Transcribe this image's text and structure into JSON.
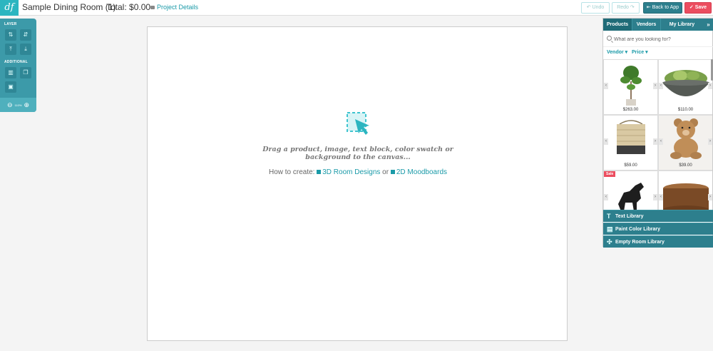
{
  "header": {
    "logo": "df",
    "project_title": "Sample Dining Room (1)",
    "total": "Total: $0.00",
    "project_details": "Project Details",
    "undo": "Undo",
    "redo": "Redo",
    "back_to_app": "Back to App",
    "save": "Save"
  },
  "toolbar": {
    "layer_label": "LAYER",
    "additional_label": "ADDITIONAL",
    "zoom": "110%"
  },
  "canvas": {
    "drop_text": "Drag a product, image, text block, color swatch or background to the canvas...",
    "howto_prefix": "How to create:",
    "link_3d": "3D Room Designs",
    "or_text": "or",
    "link_2d": "2D Moodboards"
  },
  "panel": {
    "tabs": {
      "products": "Products",
      "vendors": "Vendors",
      "library": "My Library",
      "expand": "»"
    },
    "search_placeholder": "What are you looking for?",
    "filter_vendor": "Vendor",
    "filter_price": "Price",
    "products": [
      {
        "name": "fiddle-leaf-tree",
        "price": "$263.00"
      },
      {
        "name": "succulent-bowl",
        "price": "$110.00"
      },
      {
        "name": "woven-basket",
        "price": "$59.00"
      },
      {
        "name": "teddy-bear",
        "price": "$39.00"
      },
      {
        "name": "horse-sculpture",
        "price": ""
      },
      {
        "name": "wood-side-table",
        "price": ""
      }
    ],
    "sale_badge": "Sale",
    "libraries": {
      "text": "Text Library",
      "paint": "Paint Color Library",
      "empty_room": "Empty Room Library"
    }
  },
  "colors": {
    "brand": "#2cb5c0",
    "panel": "#2d7f8d",
    "save": "#ec4d5f"
  }
}
